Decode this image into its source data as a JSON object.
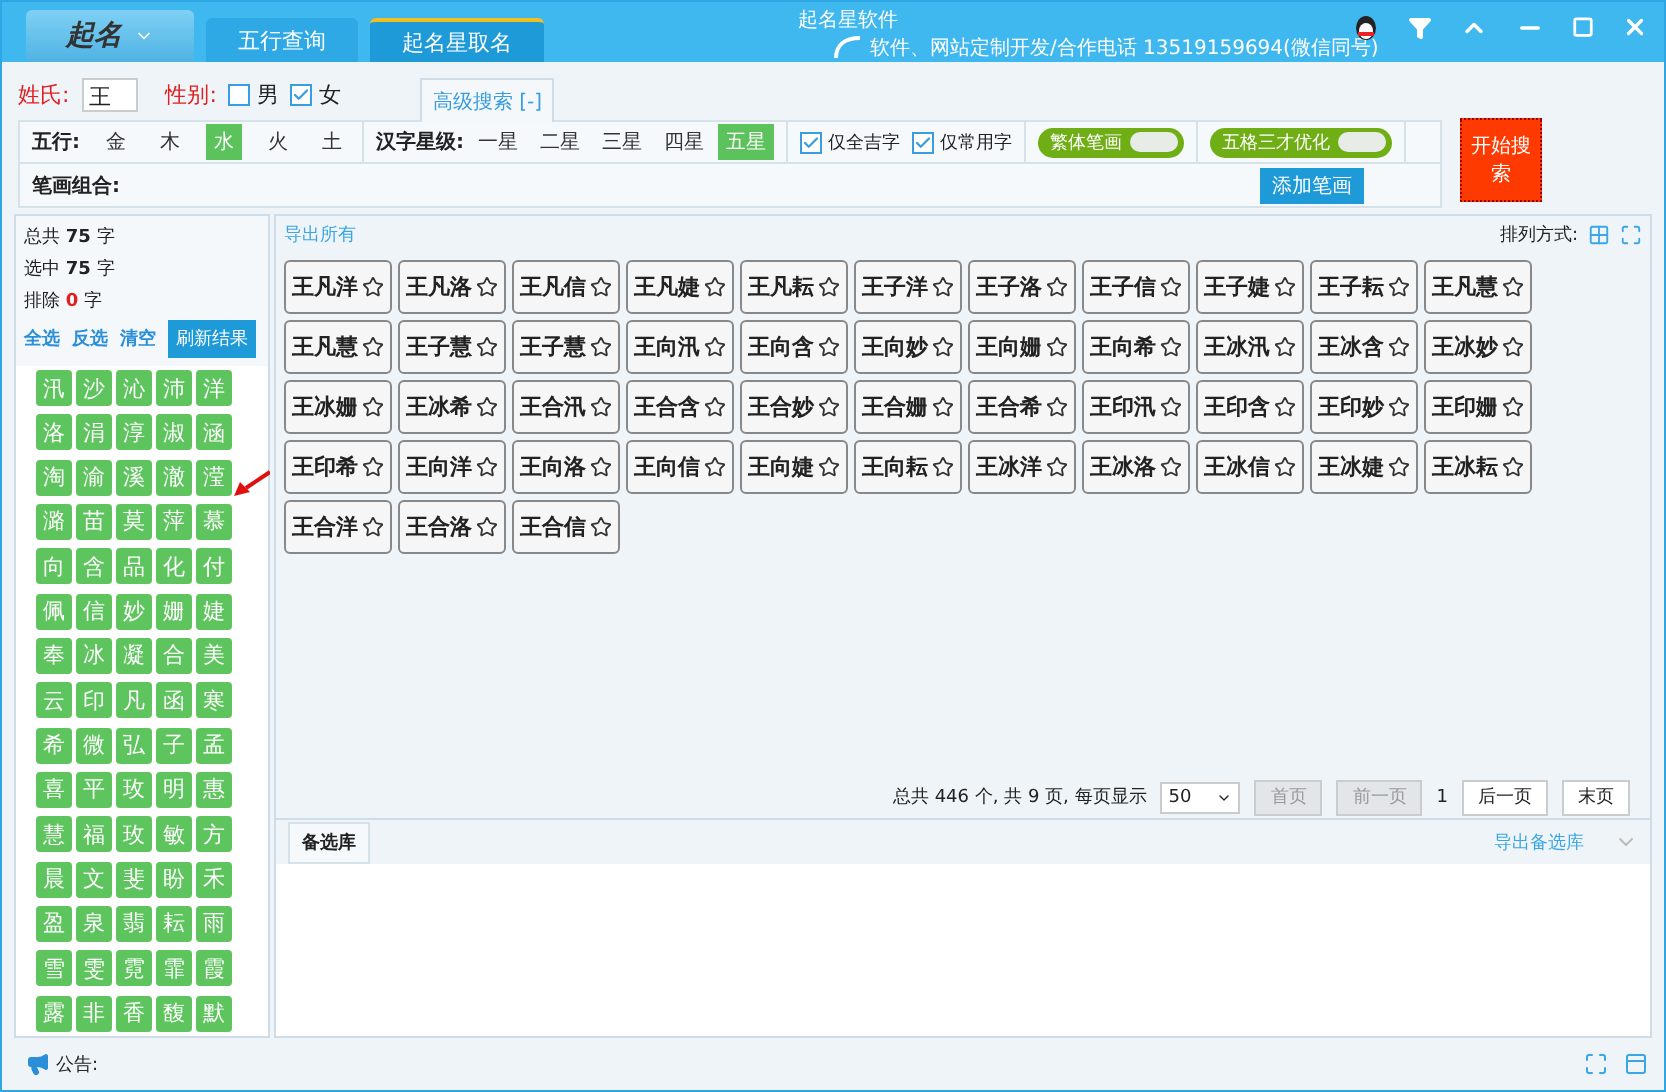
{
  "window": {
    "logo_text": "起名",
    "title": "起名星软件",
    "contact": "软件、网站定制开发/合作电话 13519159694(微信同号)"
  },
  "tabs": [
    {
      "label": "五行查询",
      "selected": false
    },
    {
      "label": "起名星取名",
      "selected": true
    }
  ],
  "form": {
    "surname_label": "姓氏:",
    "surname": "王",
    "gender_label": "性别:",
    "genders": [
      {
        "label": "男",
        "checked": false
      },
      {
        "label": "女",
        "checked": true
      }
    ],
    "advanced_tab": "高级搜索 [-]",
    "wuxing_label": "五行:",
    "wuxing": [
      {
        "label": "金",
        "selected": false
      },
      {
        "label": "木",
        "selected": false
      },
      {
        "label": "水",
        "selected": true
      },
      {
        "label": "火",
        "selected": false
      },
      {
        "label": "土",
        "selected": false
      }
    ],
    "star_label": "汉字星级:",
    "star_levels": [
      {
        "label": "一星",
        "selected": false
      },
      {
        "label": "二星",
        "selected": false
      },
      {
        "label": "三星",
        "selected": false
      },
      {
        "label": "四星",
        "selected": false
      },
      {
        "label": "五星",
        "selected": true
      }
    ],
    "filters": [
      {
        "label": "仅全吉字",
        "checked": true
      },
      {
        "label": "仅常用字",
        "checked": true
      }
    ],
    "toggles": [
      {
        "label": "繁体笔画",
        "on": false
      },
      {
        "label": "五格三才优化",
        "on": false
      }
    ],
    "strokes_label": "笔画组合:",
    "add_strokes": "添加笔画",
    "search_button": "开始搜索"
  },
  "sidebar": {
    "stats": [
      {
        "label": "总共",
        "count": "75",
        "unit": "字",
        "kind": "normal"
      },
      {
        "label": "选中",
        "count": "75",
        "unit": "字",
        "kind": "normal"
      },
      {
        "label": "排除",
        "count": "0",
        "unit": "字",
        "kind": "alert"
      }
    ],
    "links": [
      "全选",
      "反选",
      "清空"
    ],
    "refresh": "刷新结果",
    "chars": [
      "汛",
      "沙",
      "沁",
      "沛",
      "洋",
      "洛",
      "涓",
      "淳",
      "淑",
      "涵",
      "淘",
      "渝",
      "溪",
      "澈",
      "滢",
      "潞",
      "苗",
      "莫",
      "萍",
      "慕",
      "向",
      "含",
      "品",
      "化",
      "付",
      "佩",
      "信",
      "妙",
      "姗",
      "婕",
      "奉",
      "冰",
      "凝",
      "合",
      "美",
      "云",
      "印",
      "凡",
      "函",
      "寒",
      "希",
      "微",
      "弘",
      "子",
      "孟",
      "喜",
      "平",
      "玫",
      "明",
      "惠",
      "慧",
      "福",
      "玫",
      "敏",
      "方",
      "晨",
      "文",
      "斐",
      "盼",
      "禾",
      "盈",
      "泉",
      "翡",
      "耘",
      "雨",
      "雪",
      "雯",
      "霓",
      "霏",
      "霞",
      "露",
      "非",
      "香",
      "馥",
      "默"
    ]
  },
  "results": {
    "export_all": "导出所有",
    "sort_label": "排列方式:",
    "names": [
      {
        "name": "王凡洋",
        "starred": false
      },
      {
        "name": "王凡洛",
        "starred": false
      },
      {
        "name": "王凡信",
        "starred": false
      },
      {
        "name": "王凡婕",
        "starred": false
      },
      {
        "name": "王凡耘",
        "starred": false
      },
      {
        "name": "王子洋",
        "starred": false
      },
      {
        "name": "王子洛",
        "starred": false
      },
      {
        "name": "王子信",
        "starred": false
      },
      {
        "name": "王子婕",
        "starred": false
      },
      {
        "name": "王子耘",
        "starred": false
      },
      {
        "name": "王凡慧",
        "starred": false
      },
      {
        "name": "王凡慧",
        "starred": false
      },
      {
        "name": "王子慧",
        "starred": false
      },
      {
        "name": "王子慧",
        "starred": false
      },
      {
        "name": "王向汛",
        "starred": false
      },
      {
        "name": "王向含",
        "starred": false
      },
      {
        "name": "王向妙",
        "starred": false
      },
      {
        "name": "王向姗",
        "starred": false
      },
      {
        "name": "王向希",
        "starred": false
      },
      {
        "name": "王冰汛",
        "starred": false
      },
      {
        "name": "王冰含",
        "starred": false
      },
      {
        "name": "王冰妙",
        "starred": false
      },
      {
        "name": "王冰姗",
        "starred": false
      },
      {
        "name": "王冰希",
        "starred": false
      },
      {
        "name": "王合汛",
        "starred": false
      },
      {
        "name": "王合含",
        "starred": false
      },
      {
        "name": "王合妙",
        "starred": false
      },
      {
        "name": "王合姗",
        "starred": false
      },
      {
        "name": "王合希",
        "starred": false
      },
      {
        "name": "王印汛",
        "starred": false
      },
      {
        "name": "王印含",
        "starred": false
      },
      {
        "name": "王印妙",
        "starred": false
      },
      {
        "name": "王印姗",
        "starred": false
      },
      {
        "name": "王印希",
        "starred": false
      },
      {
        "name": "王向洋",
        "starred": false
      },
      {
        "name": "王向洛",
        "starred": false
      },
      {
        "name": "王向信",
        "starred": false
      },
      {
        "name": "王向婕",
        "starred": false
      },
      {
        "name": "王向耘",
        "starred": false
      },
      {
        "name": "王冰洋",
        "starred": false
      },
      {
        "name": "王冰洛",
        "starred": false
      },
      {
        "name": "王冰信",
        "starred": false
      },
      {
        "name": "王冰婕",
        "starred": false
      },
      {
        "name": "王冰耘",
        "starred": false
      },
      {
        "name": "王合洋",
        "starred": false
      },
      {
        "name": "王合洛",
        "starred": false
      },
      {
        "name": "王合信",
        "starred": false
      }
    ],
    "pager": {
      "summary": "总共 446 个, 共 9 页, 每页显示",
      "per_page": "50",
      "first": "首页",
      "prev": "前一页",
      "page": "1",
      "next": "后一页",
      "last": "末页",
      "first_disabled": true,
      "prev_disabled": true
    },
    "shortlist_tab": "备选库",
    "export_shortlist": "导出备选库"
  },
  "status_bar": {
    "notice": "公告:"
  }
}
